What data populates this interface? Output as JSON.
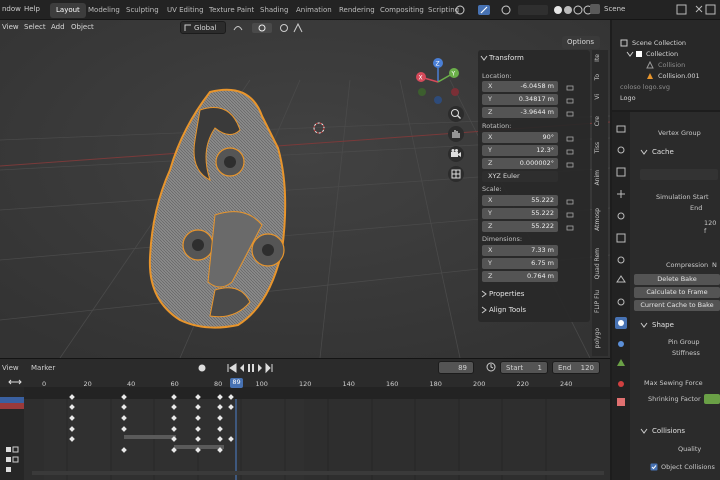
{
  "topbar": {
    "menus": [
      "ndow",
      "Help"
    ],
    "tabs": [
      "Layout",
      "Modeling",
      "Sculpting",
      "UV Editing",
      "Texture Paint",
      "Shading",
      "Animation",
      "Rendering",
      "Compositing",
      "Scripting"
    ],
    "active_tab": "Layout",
    "scene_label": "Scene"
  },
  "viewport": {
    "menus": [
      "View",
      "Select",
      "Add",
      "Object"
    ],
    "transform_orientation": "Global",
    "options_label": "Options"
  },
  "gizmo": {
    "x": "X",
    "y": "Y",
    "z": "Z"
  },
  "npanel": {
    "transform_title": "Transform",
    "location_label": "Location:",
    "location": [
      {
        "axis": "X",
        "value": "-6.0458 m"
      },
      {
        "axis": "Y",
        "value": "0.34817 m"
      },
      {
        "axis": "Z",
        "value": "-3.9644 m"
      }
    ],
    "rotation_label": "Rotation:",
    "rotation": [
      {
        "axis": "X",
        "value": "90°"
      },
      {
        "axis": "Y",
        "value": "12.3°"
      },
      {
        "axis": "Z",
        "value": "0.000002°"
      }
    ],
    "rotation_mode": "XYZ Euler",
    "scale_label": "Scale:",
    "scale": [
      {
        "axis": "X",
        "value": "55.222"
      },
      {
        "axis": "Y",
        "value": "55.222"
      },
      {
        "axis": "Z",
        "value": "55.222"
      }
    ],
    "dimensions_label": "Dimensions:",
    "dimensions": [
      {
        "axis": "X",
        "value": "7.33 m"
      },
      {
        "axis": "Y",
        "value": "6.75 m"
      },
      {
        "axis": "Z",
        "value": "0.764 m"
      }
    ],
    "properties_title": "Properties",
    "align_tools_title": "Align Tools"
  },
  "side_tabs": [
    "Ite",
    "To",
    "Vi",
    "Cre",
    "Tiss",
    "Anim",
    "Atmosp",
    "Quad Rem",
    "FLIP Flu",
    "polygo"
  ],
  "outliner": {
    "rows": [
      "Scene Collection",
      "Collection",
      "Collision",
      "Collision.001",
      "coloso logo.svg",
      "Logo"
    ]
  },
  "properties": {
    "vertex_group": "Vertex Group",
    "cache_title": "Cache",
    "simulation_start": "Simulation Start",
    "end": "End",
    "end_value": "120 f",
    "compression": "Compression",
    "compression_value": "N",
    "delete_bake": "Delete Bake",
    "calculate_to_frame": "Calculate to Frame",
    "current_cache_to_bake": "Current Cache to Bake",
    "shape_title": "Shape",
    "pin_group": "Pin Group",
    "stiffness": "Stiffness",
    "max_sewing_force": "Max Sewing Force",
    "shrinking_factor": "Shrinking Factor",
    "collisions_title": "Collisions",
    "quality": "Quality",
    "object_collisions": "Object Collisions"
  },
  "timeline": {
    "menus": [
      "View",
      "Marker"
    ],
    "current_frame": "89",
    "start_label": "Start",
    "start_value": "1",
    "end_label": "End",
    "end_value": "120",
    "ruler": [
      "0",
      "20",
      "40",
      "60",
      "80",
      "100",
      "120",
      "140",
      "160",
      "180",
      "200",
      "220",
      "240"
    ]
  },
  "colors": {
    "accent": "#4772b3",
    "selection_outline": "#e8952c",
    "playhead": "#4772b3"
  }
}
